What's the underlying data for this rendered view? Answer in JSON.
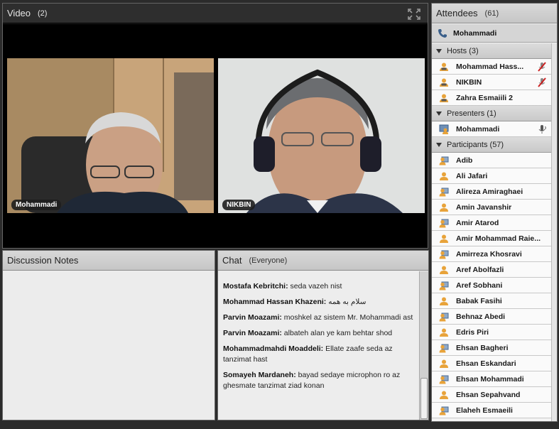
{
  "video": {
    "title": "Video",
    "count": "(2)",
    "feeds": [
      {
        "label": "Mohammadi"
      },
      {
        "label": "NIKBIN"
      }
    ]
  },
  "notes": {
    "title": "Discussion Notes"
  },
  "chat": {
    "title": "Chat",
    "scope": "(Everyone)",
    "messages": [
      {
        "sender": "Mostafa Kebritchi:",
        "text": " seda vazeh nist"
      },
      {
        "sender": "Mohammad Hassan Khazeni:",
        "text": " سلام به همه"
      },
      {
        "sender": "Parvin Moazami:",
        "text": " moshkel az sistem Mr. Mohammadi ast"
      },
      {
        "sender": "Parvin Moazami:",
        "text": " albateh alan ye kam behtar shod"
      },
      {
        "sender": "Mohammadmahdi Moaddeli:",
        "text": " Ellate zaafe seda az tanzimat hast"
      },
      {
        "sender": "Somayeh Mardaneh:",
        "text": " bayad sedaye microphon ro az ghesmate tanzimat ziad konan"
      }
    ]
  },
  "attendees": {
    "title": "Attendees",
    "count": "(61)",
    "me": "Mohammadi",
    "hosts": {
      "label": "Hosts (3)",
      "items": [
        "Mohammad Hass...",
        "NIKBIN",
        "Zahra Esmaiili 2"
      ]
    },
    "presenters": {
      "label": "Presenters (1)",
      "items": [
        "Mohammadi"
      ]
    },
    "participants": {
      "label": "Participants (57)",
      "items": [
        "Adib",
        "Ali Jafari",
        "Alireza Amiraghaei",
        "Amin Javanshir",
        "Amir Atarod",
        "Amir Mohammad Raie...",
        "Amirreza Khosravi",
        "Aref Abolfazli",
        "Aref Sobhani",
        "Babak Fasihi",
        "Behnaz Abedi",
        "Edris Piri",
        "Ehsan Bagheri",
        "Ehsan Eskandari",
        "Ehsan Mohammadi",
        "Ehsan Sepahvand",
        "Elaheh Esmaeili"
      ]
    }
  },
  "colors": {
    "user_icon": "#e8a33a",
    "muted_mic": "#cc2222",
    "pod_header": "#cfcfcf"
  }
}
